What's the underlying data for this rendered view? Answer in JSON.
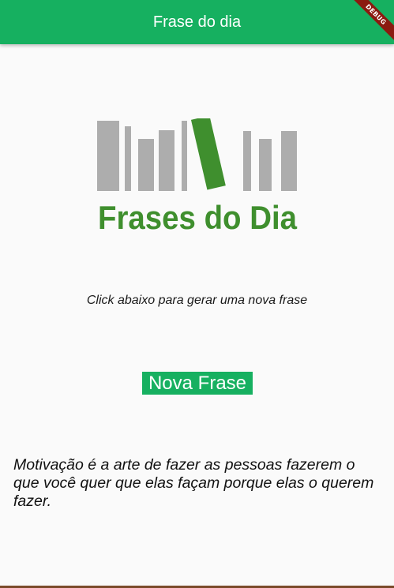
{
  "appbar": {
    "title": "Frase do dia",
    "color": "#16b060"
  },
  "debug_banner": {
    "label": "DEBUG",
    "color": "#8b1a10"
  },
  "logo": {
    "text": "Frases do Dia",
    "gray": "#adadad",
    "green": "#3f8f2e"
  },
  "instruction": "Click abaixo para gerar uma nova frase",
  "button": {
    "label": "Nova Frase"
  },
  "quote": "Motivação é a arte de fazer as pessoas fazerem o que você quer que elas façam porque elas o querem fazer."
}
